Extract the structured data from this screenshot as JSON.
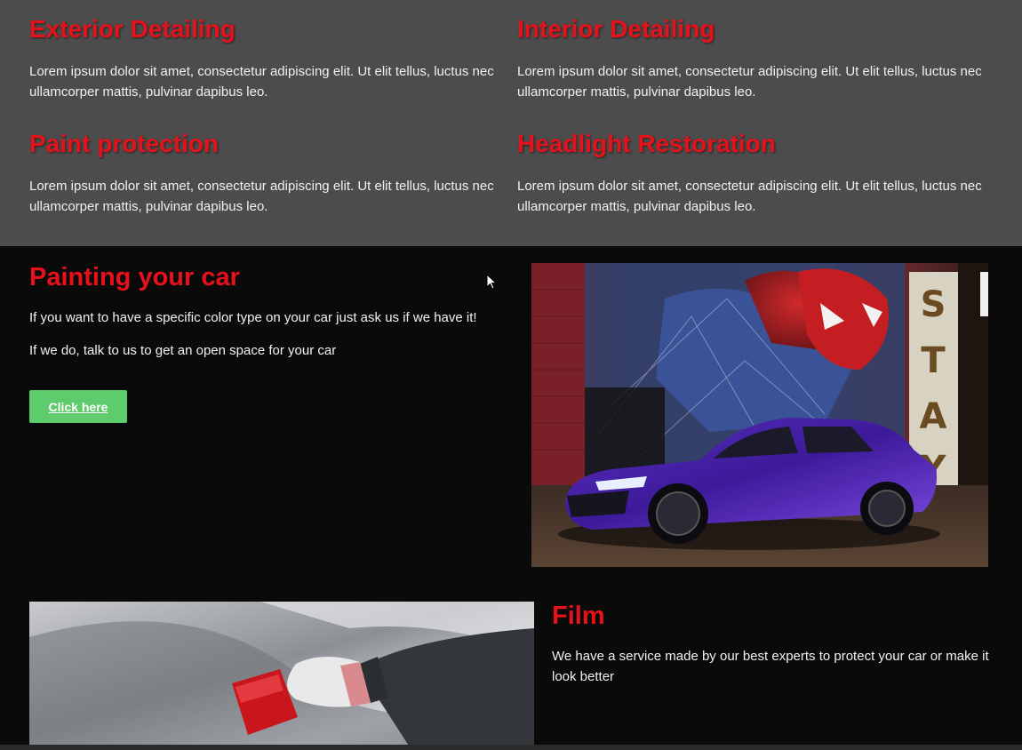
{
  "services": [
    {
      "title": "Exterior Detailing",
      "text": "Lorem ipsum dolor sit amet, consectetur adipiscing elit. Ut elit tellus, luctus nec ullamcorper mattis, pulvinar dapibus leo."
    },
    {
      "title": "Interior Detailing",
      "text": "Lorem ipsum dolor sit amet, consectetur adipiscing elit. Ut elit tellus, luctus nec ullamcorper mattis, pulvinar dapibus leo."
    },
    {
      "title": "Paint protection",
      "text": "Lorem ipsum dolor sit amet, consectetur adipiscing elit. Ut elit tellus, luctus nec ullamcorper mattis, pulvinar dapibus leo."
    },
    {
      "title": "Headlight Restoration",
      "text": "Lorem ipsum dolor sit amet, consectetur adipiscing elit. Ut elit tellus, luctus nec ullamcorper mattis, pulvinar dapibus leo."
    }
  ],
  "painting": {
    "title": "Painting your car",
    "line1": "If you want to have a specific color type on your car just ask us if we have it!",
    "line2": "If we do, talk to us to get an open space for your car",
    "button_label": "Click here"
  },
  "car_image": {
    "sign_letters": [
      "S",
      "T",
      "A",
      "Y"
    ]
  },
  "film": {
    "title": "Film",
    "text": "We have a service made by our best experts to protect your car or make it look better"
  },
  "colors": {
    "accent_red": "#e5121b",
    "button_green": "#5ecb6c",
    "services_bg": "#4c4c4c",
    "dark_bg": "#0a0a0a"
  }
}
